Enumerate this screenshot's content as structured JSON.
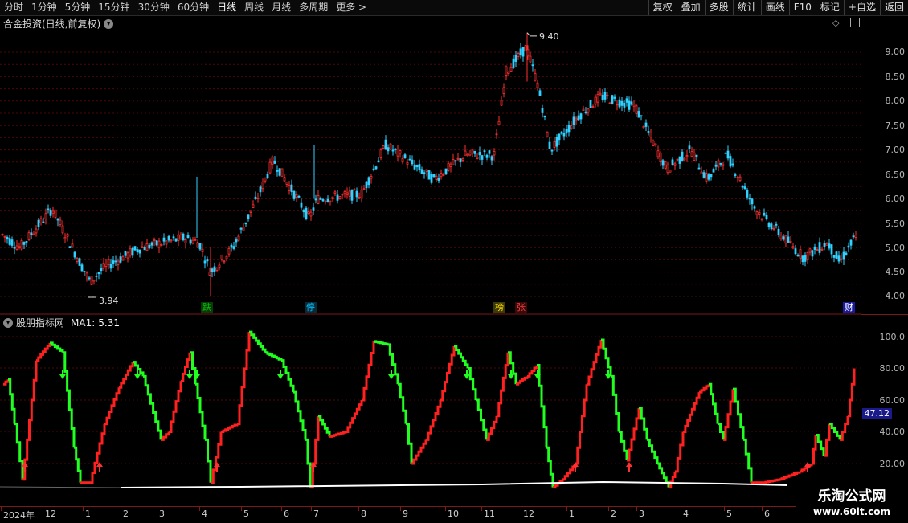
{
  "toolbar": {
    "periods": [
      "分时",
      "1分钟",
      "5分钟",
      "15分钟",
      "30分钟",
      "60分钟",
      "日线",
      "周线",
      "月线",
      "多周期",
      "更多 >"
    ],
    "active_period": "日线",
    "right_buttons": [
      "复权",
      "叠加",
      "多股",
      "统计",
      "画线",
      "F10",
      "标记",
      "+自选",
      "返回"
    ]
  },
  "price_panel": {
    "title": "合金投资(日线,前复权)",
    "high_label": "9.40",
    "low_label": "3.94",
    "y_ticks": [
      "9.00",
      "8.50",
      "8.00",
      "7.50",
      "7.00",
      "6.50",
      "6.00",
      "5.50",
      "5.00",
      "4.50",
      "4.00"
    ],
    "badges": [
      {
        "text": "跌",
        "color": "#00c000",
        "bg": "#0a3a0a"
      },
      {
        "text": "停",
        "color": "#00c8ff",
        "bg": "#0a2a3a"
      },
      {
        "text": "榜",
        "color": "#ffd800",
        "bg": "#3a3a0a"
      },
      {
        "text": "张",
        "color": "#ff4040",
        "bg": "#3a0a0a"
      },
      {
        "text": "财",
        "color": "#ffffff",
        "bg": "#1a1aa0"
      }
    ]
  },
  "indicator_panel": {
    "title": "股朋指标网",
    "ma_label": "MA1:",
    "ma_value": "5.31",
    "y_ticks": [
      "100.0",
      "80.00",
      "60.00",
      "40.00",
      "20.00"
    ],
    "current_value": "47.12"
  },
  "date_axis": [
    "2024年",
    "12",
    "1",
    "2",
    "3",
    "4",
    "5",
    "6",
    "7",
    "8",
    "9",
    "10",
    "11",
    "12",
    "1",
    "2",
    "3",
    "4",
    "5",
    "6"
  ],
  "watermark": {
    "line1": "乐淘公式网",
    "line2": "www.60lt.com"
  },
  "colors": {
    "up": "#ff3030",
    "down": "#30d0ff",
    "ind_up": "#ff2020",
    "ind_down": "#20ff20",
    "grid": "#5a0a0a",
    "axis": "#7a1a1a"
  }
}
